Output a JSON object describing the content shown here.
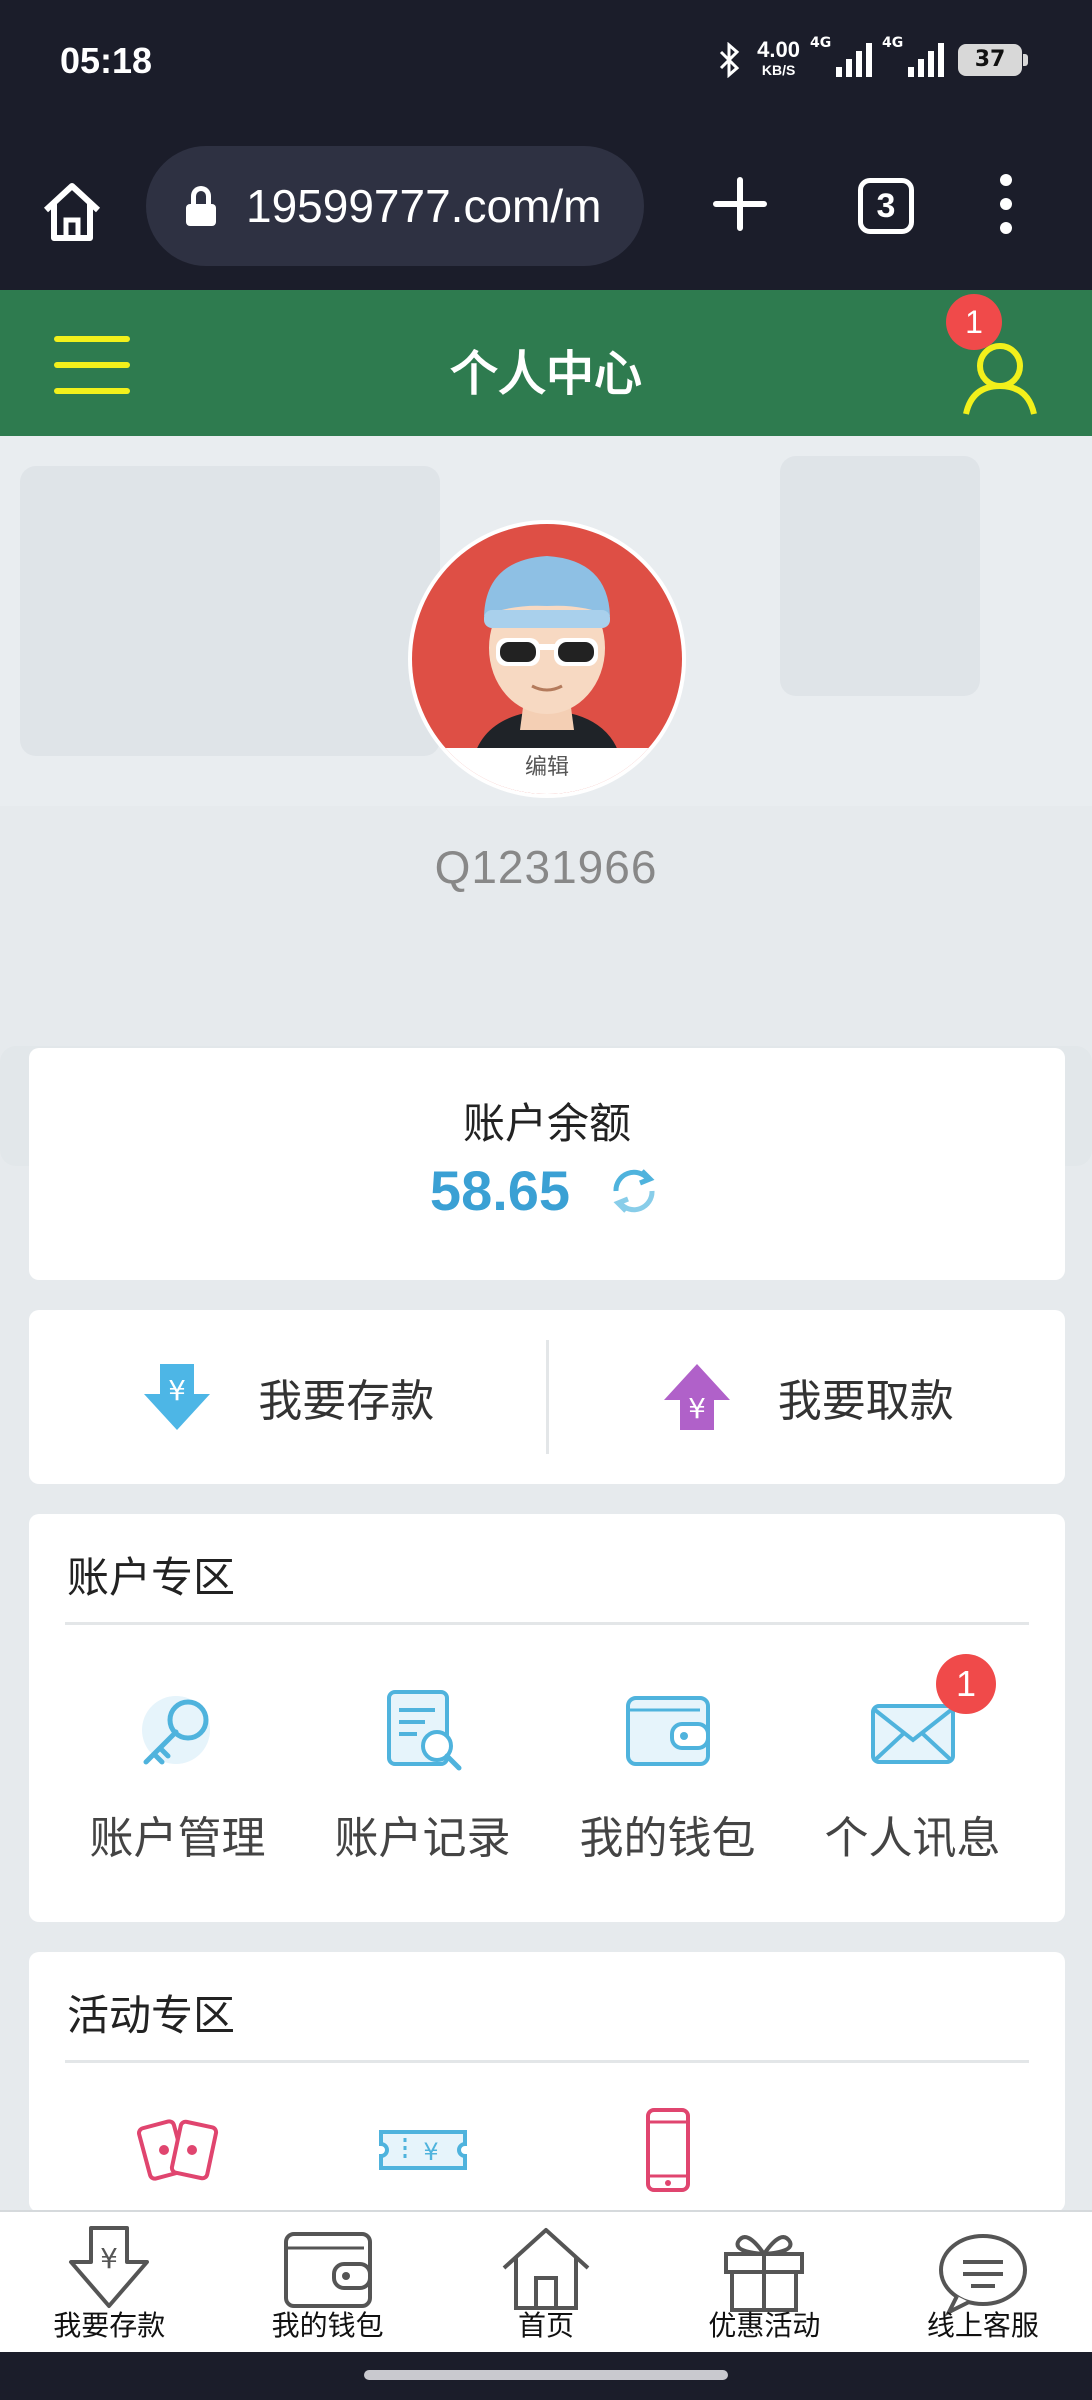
{
  "status_bar": {
    "time": "05:18",
    "net_speed": "4.00",
    "net_unit": "KB/S",
    "network_1": "4G",
    "network_2": "4G",
    "battery": "37"
  },
  "browser": {
    "url": "19599777.com/m",
    "tab_count": "3"
  },
  "header": {
    "title": "个人中心",
    "user_badge": "1",
    "accent_color": "#2e7b4f",
    "icon_color": "#f2f01b"
  },
  "profile": {
    "edit_label": "编辑",
    "username": "Q1231966"
  },
  "balance": {
    "label": "账户余额",
    "value": "58.65",
    "value_color": "#3aa0d4"
  },
  "actions": {
    "deposit_label": "我要存款",
    "withdraw_label": "我要取款"
  },
  "account_section": {
    "title": "账户专区",
    "items": [
      {
        "label": "账户管理",
        "icon": "key-icon"
      },
      {
        "label": "账户记录",
        "icon": "record-search-icon"
      },
      {
        "label": "我的钱包",
        "icon": "wallet-icon"
      },
      {
        "label": "个人讯息",
        "icon": "mail-icon",
        "badge": "1"
      }
    ]
  },
  "activity_section": {
    "title": "活动专区",
    "items": [
      {
        "icon": "red-envelope-icon"
      },
      {
        "icon": "coupon-icon"
      },
      {
        "icon": "phone-icon"
      }
    ]
  },
  "bottom_nav": {
    "items": [
      {
        "label": "我要存款",
        "icon": "deposit-icon"
      },
      {
        "label": "我的钱包",
        "icon": "wallet-icon"
      },
      {
        "label": "首页",
        "icon": "home-icon"
      },
      {
        "label": "优惠活动",
        "icon": "gift-icon"
      },
      {
        "label": "线上客服",
        "icon": "chat-icon"
      }
    ]
  }
}
